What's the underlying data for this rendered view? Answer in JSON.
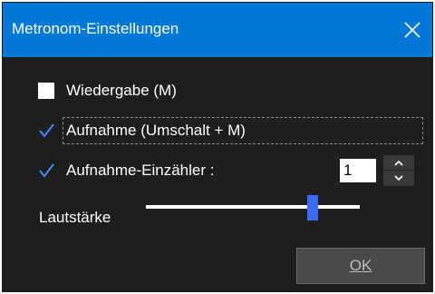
{
  "window": {
    "title": "Metronom-Einstellungen",
    "close_icon": "close-icon"
  },
  "options": [
    {
      "label": "Wiedergabe (M)",
      "checked": false
    },
    {
      "label": "Aufnahme (Umschalt + M)",
      "checked": true,
      "focused": true
    },
    {
      "label": "Aufnahme-Einzähler :",
      "checked": true
    }
  ],
  "count_in": {
    "value": "1",
    "up_icon": "chevron-up-icon",
    "down_icon": "chevron-down-icon"
  },
  "volume": {
    "label": "Lautstärke",
    "level": 0.78
  },
  "ok_button": {
    "label": "OK"
  },
  "colors": {
    "titlebar": "#0078d7",
    "background": "#1e1e1e",
    "accent": "#3b6cf7",
    "text": "#ffffff"
  }
}
